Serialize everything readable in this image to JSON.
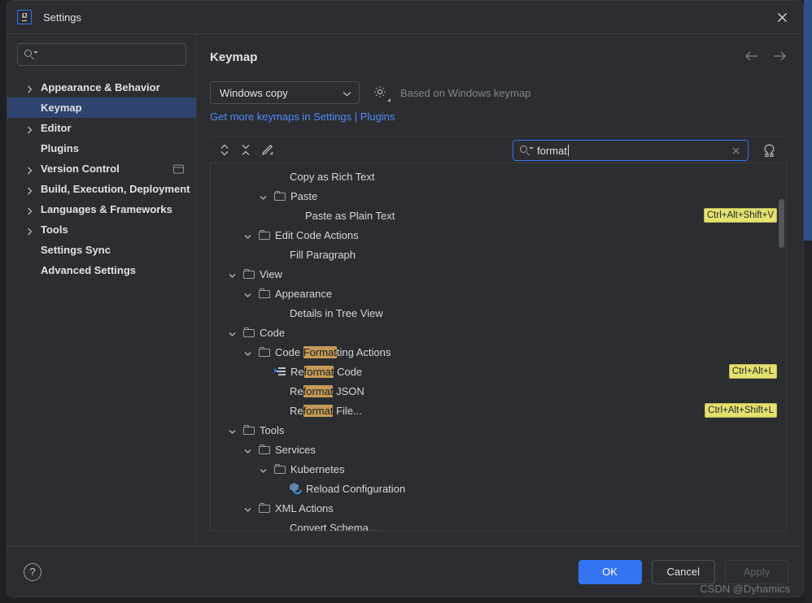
{
  "window": {
    "title": "Settings",
    "logo_icon": "intellij-idea-logo",
    "close_icon": "close-icon"
  },
  "sidebar": {
    "search": {
      "placeholder": "",
      "value": "",
      "icon": "search-icon"
    },
    "items": [
      {
        "label": "Appearance & Behavior",
        "expandable": true,
        "selected": false,
        "trailing_icon": ""
      },
      {
        "label": "Keymap",
        "expandable": false,
        "selected": true,
        "trailing_icon": ""
      },
      {
        "label": "Editor",
        "expandable": true,
        "selected": false,
        "trailing_icon": ""
      },
      {
        "label": "Plugins",
        "expandable": false,
        "selected": false,
        "trailing_icon": ""
      },
      {
        "label": "Version Control",
        "expandable": true,
        "selected": false,
        "trailing_icon": "panel-icon"
      },
      {
        "label": "Build, Execution, Deployment",
        "expandable": true,
        "selected": false,
        "trailing_icon": ""
      },
      {
        "label": "Languages & Frameworks",
        "expandable": true,
        "selected": false,
        "trailing_icon": ""
      },
      {
        "label": "Tools",
        "expandable": true,
        "selected": false,
        "trailing_icon": ""
      },
      {
        "label": "Settings Sync",
        "expandable": false,
        "selected": false,
        "trailing_icon": ""
      },
      {
        "label": "Advanced Settings",
        "expandable": false,
        "selected": false,
        "trailing_icon": ""
      }
    ]
  },
  "main": {
    "page_title": "Keymap",
    "nav_back_icon": "arrow-left-icon",
    "nav_forward_icon": "arrow-right-icon",
    "keymap_select": {
      "value": "Windows copy",
      "chevron_icon": "chevron-down-icon"
    },
    "gear_icon": "gear-icon",
    "based_on": "Based on Windows keymap",
    "get_more_link": "Get more keymaps in Settings | Plugins",
    "toolbar": [
      {
        "name": "expand-all-icon",
        "title": "Expand All"
      },
      {
        "name": "collapse-all-icon",
        "title": "Collapse All"
      },
      {
        "name": "edit-shortcut-icon",
        "title": "Edit Shortcut"
      }
    ],
    "search": {
      "value": "format",
      "placeholder": "",
      "icon": "search-icon",
      "clear_icon": "close-icon"
    },
    "find_by_shortcut_icon": "find-by-shortcut-icon"
  },
  "tree": {
    "highlight_term": "format",
    "rows": [
      {
        "indent": 3,
        "label": "Copy as Rich Text",
        "node": "leaf",
        "icon": "",
        "shortcut": ""
      },
      {
        "indent": 2,
        "label": "Paste",
        "node": "folder",
        "icon": "folder-icon",
        "shortcut": ""
      },
      {
        "indent": 4,
        "label": "Paste as Plain Text",
        "node": "leaf",
        "icon": "",
        "shortcut": "Ctrl+Alt+Shift+V"
      },
      {
        "indent": 1,
        "label": "Edit Code Actions",
        "node": "folder",
        "icon": "folder-icon",
        "shortcut": ""
      },
      {
        "indent": 3,
        "label": "Fill Paragraph",
        "node": "leaf",
        "icon": "",
        "shortcut": ""
      },
      {
        "indent": 0,
        "label": "View",
        "node": "folder",
        "icon": "folder-icon",
        "shortcut": ""
      },
      {
        "indent": 1,
        "label": "Appearance",
        "node": "folder",
        "icon": "folder-icon",
        "shortcut": ""
      },
      {
        "indent": 3,
        "label": "Details in Tree View",
        "node": "leaf",
        "icon": "",
        "shortcut": ""
      },
      {
        "indent": 0,
        "label": "Code",
        "node": "folder",
        "icon": "folder-icon",
        "shortcut": ""
      },
      {
        "indent": 1,
        "label": "Code Formatting Actions",
        "node": "folder",
        "icon": "folder-icon",
        "shortcut": ""
      },
      {
        "indent": 2,
        "label": "Reformat Code",
        "node": "leaf",
        "icon": "reformat-code-icon",
        "shortcut": "Ctrl+Alt+L"
      },
      {
        "indent": 3,
        "label": "Reformat JSON",
        "node": "leaf",
        "icon": "",
        "shortcut": ""
      },
      {
        "indent": 3,
        "label": "Reformat File...",
        "node": "leaf",
        "icon": "",
        "shortcut": "Ctrl+Alt+Shift+L"
      },
      {
        "indent": 0,
        "label": "Tools",
        "node": "folder",
        "icon": "folder-icon",
        "shortcut": ""
      },
      {
        "indent": 1,
        "label": "Services",
        "node": "folder",
        "icon": "folder-icon",
        "shortcut": ""
      },
      {
        "indent": 2,
        "label": "Kubernetes",
        "node": "folder",
        "icon": "folder-icon",
        "shortcut": ""
      },
      {
        "indent": 3,
        "label": "Reload Configuration",
        "node": "leaf",
        "icon": "kubernetes-reload-icon",
        "shortcut": ""
      },
      {
        "indent": 1,
        "label": "XML Actions",
        "node": "folder",
        "icon": "folder-icon",
        "shortcut": ""
      },
      {
        "indent": 3,
        "label": "Convert Schema...",
        "node": "leaf",
        "icon": "",
        "shortcut": ""
      }
    ]
  },
  "footer": {
    "help_label": "?",
    "ok_label": "OK",
    "cancel_label": "Cancel",
    "apply_label": "Apply"
  },
  "watermark": "CSDN @Dyhamics",
  "colors": {
    "accent": "#3574f0",
    "selection": "#2e436e",
    "shortcut_badge": "#e4e26e",
    "match_highlight": "#c49a56",
    "link": "#548af7",
    "panel_bg": "#2b2d30"
  }
}
